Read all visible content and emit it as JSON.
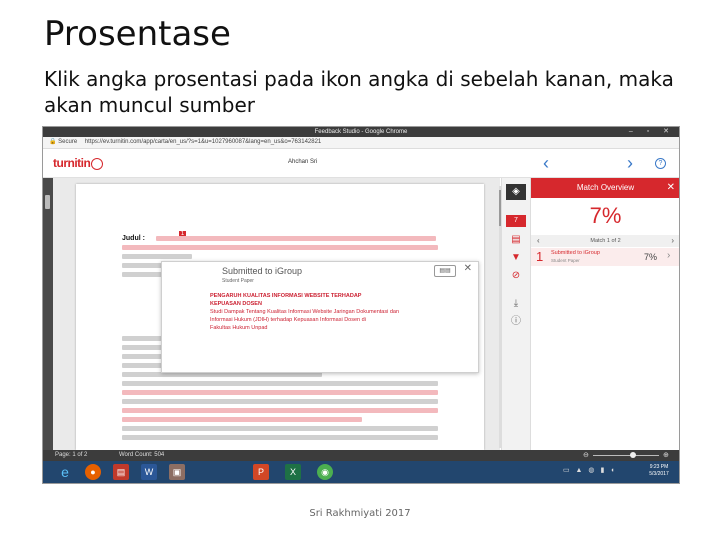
{
  "slide": {
    "title": "Prosentase",
    "subtitle": "Klik angka prosentasi pada ikon angka di sebelah kanan, maka akan muncul sumber",
    "footer": "Sri Rakhmiyati 2017"
  },
  "browser": {
    "window_title": "Feedback Studio - Google Chrome",
    "window_buttons": "– ▫ ✕",
    "secure_label": "Secure",
    "url": "https://ev.turnitin.com/app/carta/en_us/?s=1&u=1027960087&lang=en_us&o=763142821"
  },
  "toolbar": {
    "logo_text": "turnitin",
    "author": "Ahchan Sri",
    "prev": "‹",
    "next": "›",
    "help": "?"
  },
  "document": {
    "heading": "Judul :",
    "marker": "1",
    "highlight_color": "#f3b9bd"
  },
  "popup": {
    "title": "Submitted to iGroup",
    "subtitle": "Student Paper",
    "buttons": "▤▤",
    "close": "✕",
    "lines": [
      "PENGARUH KUALITAS INFORMASI WEBSITE TERHADAP",
      "KEPUASAN DOSEN",
      "Studi Dampak Tentang Kualitas Informasi Website Jaringan Dokumentasi dan",
      "Informasi Hukum (JDIH) terhadap Kepuasan Informasi Dosen di",
      "Fakultas Hukum Unpad"
    ]
  },
  "right_toolbar": {
    "percent_badge": "7",
    "icons": [
      "layers-icon",
      "filter-icon",
      "funnel-icon",
      "no-icon",
      "download-icon",
      "info-icon"
    ]
  },
  "match_panel": {
    "title": "Match Overview",
    "close": "✕",
    "percent": "7%",
    "nav_label": "Match 1 of 2",
    "rows": [
      {
        "number": "1",
        "source": "Submitted to iGroup",
        "type": "Student Paper",
        "percent": "7%"
      }
    ],
    "accent_color": "#d6282d"
  },
  "statusbar": {
    "page": "Page: 1 of 2",
    "word_count": "Word Count: 504",
    "zoom_level_fraction": 0.6
  },
  "taskbar": {
    "clock_time": "9:23 PM",
    "clock_date": "5/3/2017",
    "apps": [
      "internet-explorer-icon",
      "firefox-icon",
      "pdf-icon",
      "word-icon",
      "photos-icon",
      "powerpoint-icon",
      "excel-icon",
      "chrome-icon"
    ]
  }
}
